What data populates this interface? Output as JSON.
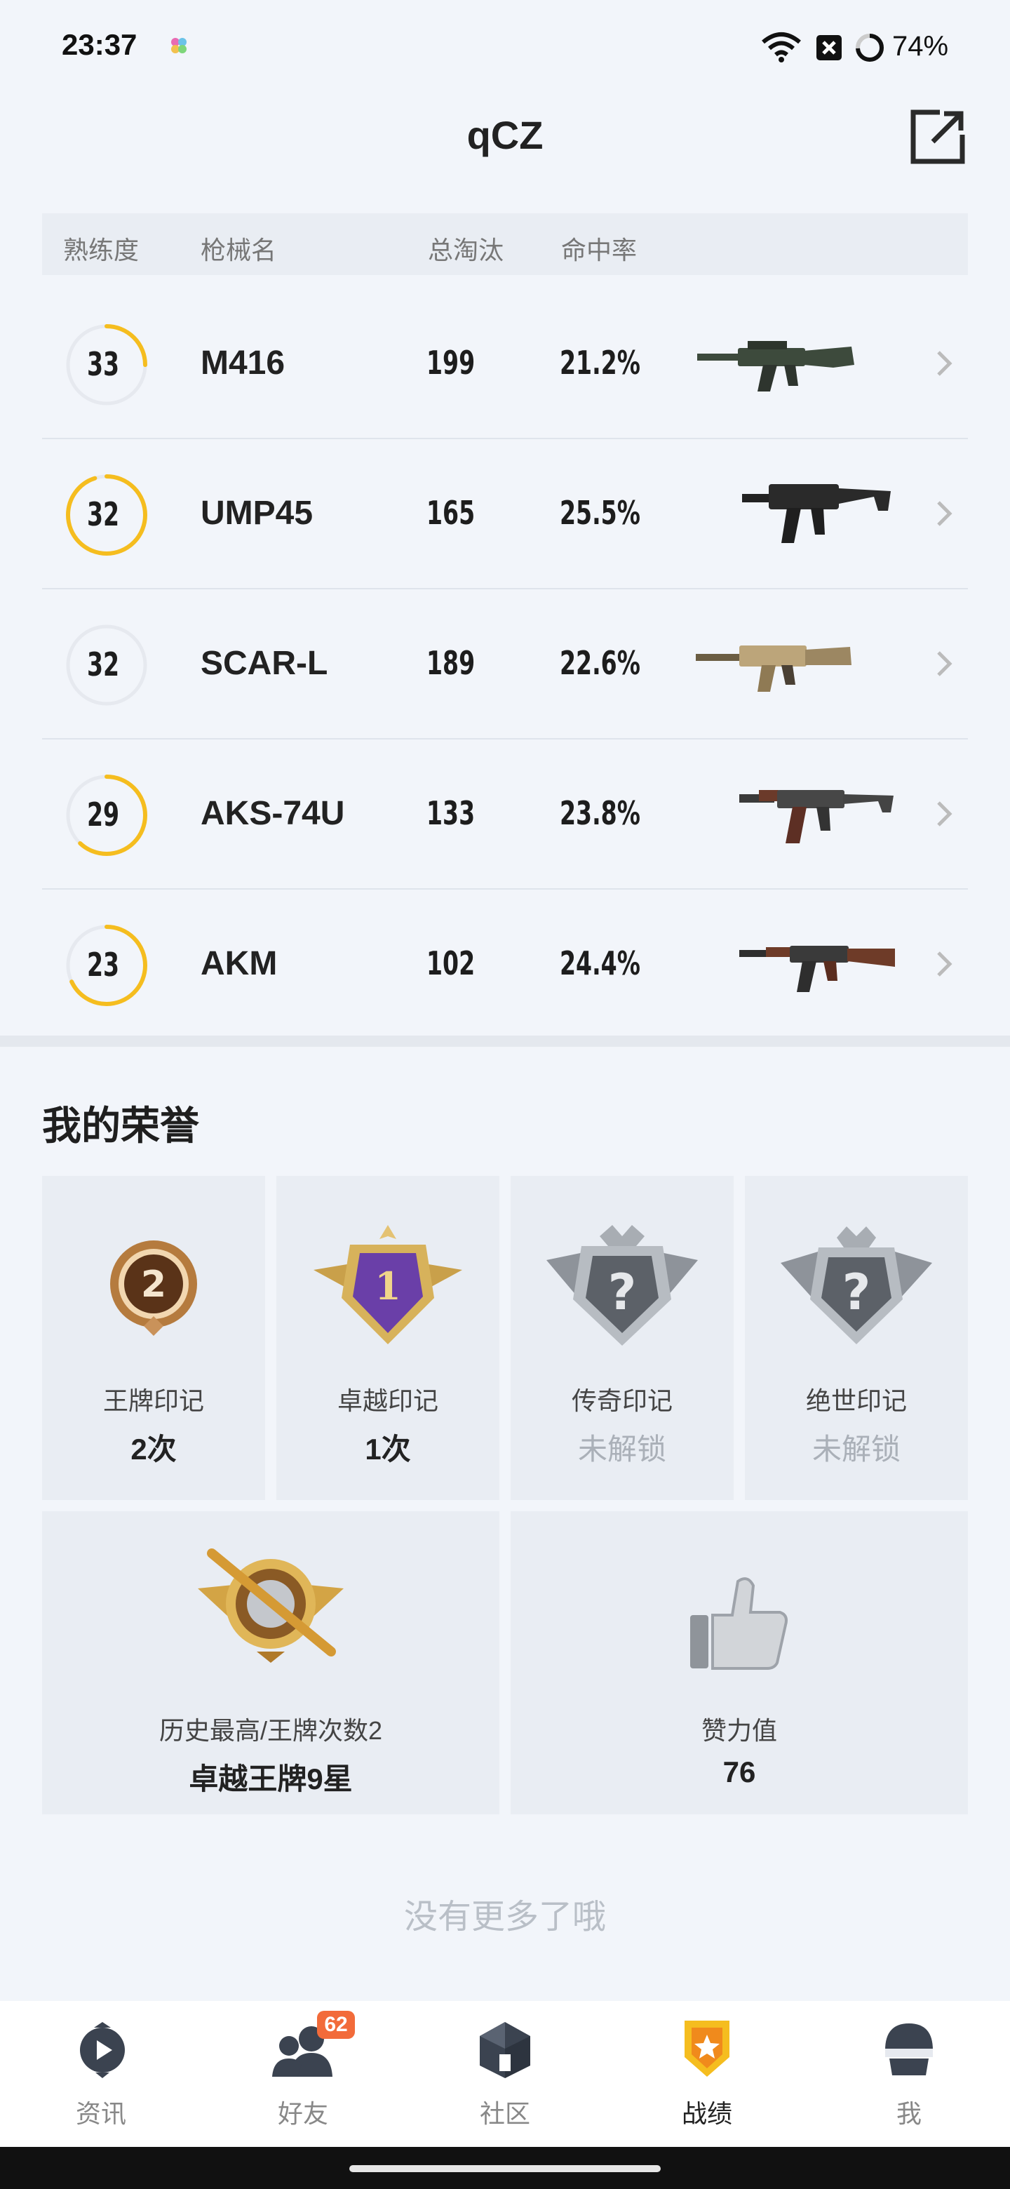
{
  "status_bar": {
    "time": "23:37",
    "battery": "74%"
  },
  "header": {
    "title": "qCZ"
  },
  "table": {
    "columns": [
      "熟练度",
      "枪械名",
      "总淘汰",
      "命中率"
    ],
    "rows": [
      {
        "level": "33",
        "name": "M416",
        "kills": "199",
        "accuracy": "21.2%",
        "progress": 0.25,
        "weapon_icon": "m416-rifle-icon"
      },
      {
        "level": "32",
        "name": "UMP45",
        "kills": "165",
        "accuracy": "25.5%",
        "progress": 0.95,
        "weapon_icon": "ump45-smg-icon"
      },
      {
        "level": "32",
        "name": "SCAR-L",
        "kills": "189",
        "accuracy": "22.6%",
        "progress": 0.0,
        "weapon_icon": "scar-l-rifle-icon"
      },
      {
        "level": "29",
        "name": "AKS-74U",
        "kills": "133",
        "accuracy": "23.8%",
        "progress": 0.62,
        "weapon_icon": "aks-74u-icon"
      },
      {
        "level": "23",
        "name": "AKM",
        "kills": "102",
        "accuracy": "24.4%",
        "progress": 0.68,
        "weapon_icon": "akm-rifle-icon"
      }
    ]
  },
  "honor": {
    "title": "我的荣誉",
    "badges": [
      {
        "label": "王牌印记",
        "value": "2次",
        "locked": false,
        "icon": "ace-badge-icon"
      },
      {
        "label": "卓越印记",
        "value": "1次",
        "locked": false,
        "icon": "excellence-badge-icon"
      },
      {
        "label": "传奇印记",
        "value": "未解锁",
        "locked": true,
        "icon": "legend-badge-locked-icon"
      },
      {
        "label": "绝世印记",
        "value": "未解锁",
        "locked": true,
        "icon": "peerless-badge-locked-icon"
      }
    ],
    "highest": {
      "label": "历史最高/王牌次数2",
      "value": "卓越王牌9星",
      "icon": "rank-emblem-icon"
    },
    "likes": {
      "label": "赞力值",
      "value": "76",
      "icon": "thumbs-up-icon"
    }
  },
  "footer_text": "没有更多了哦",
  "nav": {
    "items": [
      {
        "label": "资讯",
        "icon": "news-icon",
        "active": false
      },
      {
        "label": "好友",
        "icon": "friends-icon",
        "active": false,
        "badge": "62"
      },
      {
        "label": "社区",
        "icon": "community-icon",
        "active": false
      },
      {
        "label": "战绩",
        "icon": "record-icon",
        "active": true
      },
      {
        "label": "我",
        "icon": "profile-icon",
        "active": false
      }
    ]
  },
  "colors": {
    "accent": "#f5bd1f",
    "ring_track": "#e6e9ef",
    "badge_red": "#f26b3a"
  }
}
